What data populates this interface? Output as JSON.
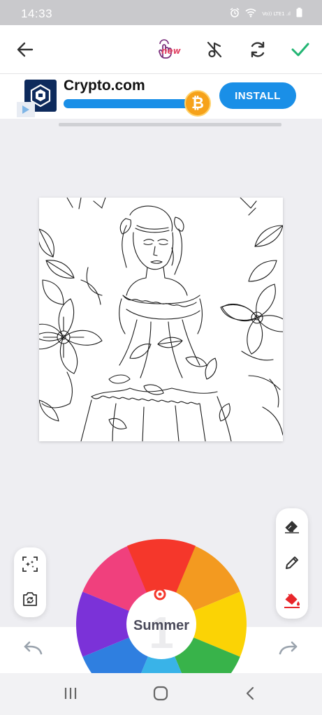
{
  "status_bar": {
    "time": "14:33",
    "icons": [
      "alarm-icon",
      "wifi-icon",
      "signal-icon",
      "battery-icon"
    ],
    "signal_text": "Vo)) LTE1 .ıl"
  },
  "toolbar": {
    "new_badge": "new",
    "accent_color": "#22b573"
  },
  "ad": {
    "brand": "Crypto.com",
    "cta": "INSTALL",
    "coin_symbol": "₿"
  },
  "wheel": {
    "palette_name": "Summer",
    "page_number": "1",
    "colors": [
      "#f5372b",
      "#f39a20",
      "#fbd305",
      "#38b34a",
      "#39b3e8",
      "#2f7fe0",
      "#7b32d8",
      "#f0407d"
    ]
  },
  "side_tools": {
    "left": [
      "magic-icon",
      "camera-rotate-icon"
    ],
    "right": [
      "eraser-icon",
      "pencil-icon",
      "fill-bucket-icon"
    ]
  }
}
